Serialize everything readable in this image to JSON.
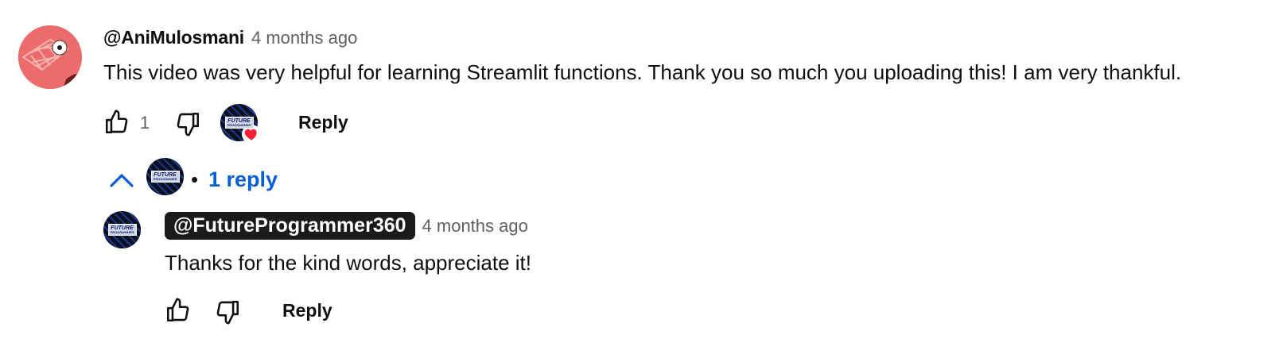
{
  "comment": {
    "author": "@AniMulosmani",
    "timestamp": "4 months ago",
    "text": "This video was very helpful for learning Streamlit functions. Thank you so much you uploading this! I am very thankful.",
    "likes": "1",
    "reply_label": "Reply",
    "hearted_by_creator": true,
    "avatar_icon": "soccer-goal-avatar",
    "avatar_color": "#ec6b6b"
  },
  "replies_toggle": {
    "separator": "•",
    "label": "1 reply",
    "color": "#065fd4"
  },
  "reply": {
    "author": "@FutureProgrammer360",
    "timestamp": "4 months ago",
    "text": "Thanks for the kind words, appreciate it!",
    "reply_label": "Reply",
    "author_chip_color": "#1b1b1b"
  },
  "channel_logo": {
    "line1": "FUTURE",
    "line2": "PROGRAMMER"
  }
}
